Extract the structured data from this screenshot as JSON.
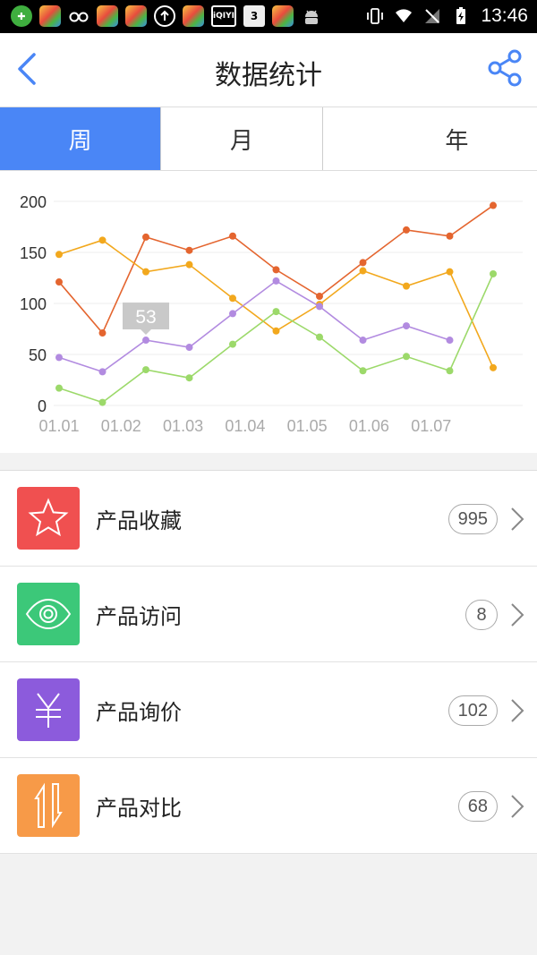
{
  "status_bar": {
    "time": "13:46",
    "calendar_day": "3",
    "iqiyi_label": "iQIYI",
    "icons": [
      "plus-app-icon",
      "app-icon",
      "glasses-icon",
      "app-icon",
      "app-icon",
      "upload-icon",
      "app-icon",
      "iqiyi-icon",
      "calendar-icon",
      "app-icon",
      "android-icon",
      "vibrate-icon",
      "wifi-icon",
      "no-sim-icon",
      "battery-icon"
    ]
  },
  "header": {
    "title": "数据统计",
    "back_icon": "chevron-left-icon",
    "share_icon": "share-icon",
    "accent": "#4a86f6"
  },
  "tabs": [
    {
      "label": "周",
      "active": true
    },
    {
      "label": "月",
      "active": false
    },
    {
      "label": "年",
      "active": false
    }
  ],
  "chart_data": {
    "type": "line",
    "x": [
      0,
      0.7,
      1.4,
      2.1,
      2.8,
      3.5,
      4.2,
      4.9,
      5.6,
      6.3,
      7.0
    ],
    "x_tick_labels": [
      "01.01",
      "01.02",
      "01.03",
      "01.04",
      "01.05",
      "01.06",
      "01.07"
    ],
    "ylim": [
      0,
      200
    ],
    "y_ticks": [
      0,
      50,
      100,
      150,
      200
    ],
    "grid": true,
    "tooltip": {
      "value": "53"
    },
    "series": [
      {
        "color": "#e4652f",
        "values": [
          121,
          71,
          165,
          152,
          166,
          133,
          107,
          140,
          172,
          166,
          196
        ]
      },
      {
        "color": "#f2a81d",
        "values": [
          148,
          162,
          131,
          138,
          105,
          73,
          99,
          132,
          117,
          131,
          37
        ]
      },
      {
        "color": "#b28be0",
        "values": [
          47,
          33,
          64,
          57,
          90,
          122,
          97,
          64,
          78,
          64,
          null
        ]
      },
      {
        "color": "#9cd96a",
        "values": [
          17,
          3,
          35,
          27,
          60,
          92,
          67,
          34,
          48,
          34,
          129
        ]
      }
    ]
  },
  "list": [
    {
      "label": "产品收藏",
      "count": "995",
      "icon": "star-icon",
      "color": "#f05050"
    },
    {
      "label": "产品访问",
      "count": "8",
      "icon": "eye-icon",
      "color": "#3cc879"
    },
    {
      "label": "产品询价",
      "count": "102",
      "icon": "yen-icon",
      "color": "#8c5bdc"
    },
    {
      "label": "产品对比",
      "count": "68",
      "icon": "swap-arrows-icon",
      "color": "#f79a48"
    }
  ]
}
